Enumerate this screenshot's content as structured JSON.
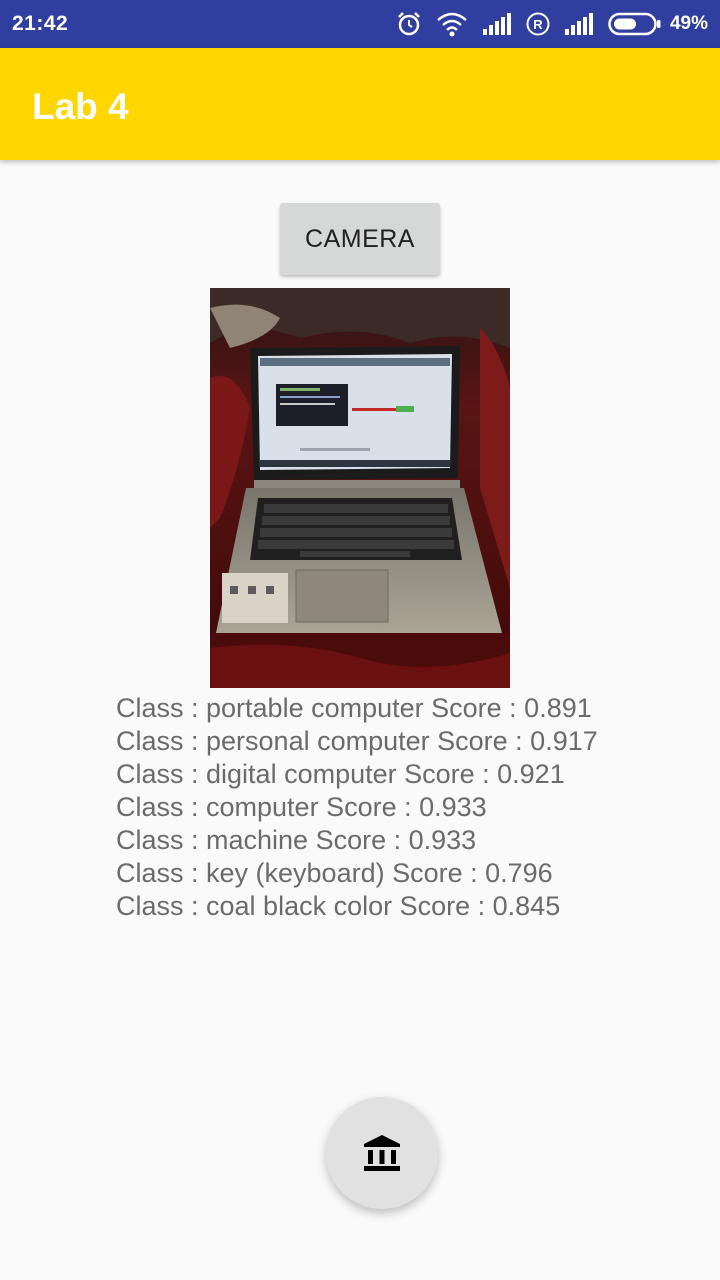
{
  "status_bar": {
    "time": "21:42",
    "battery_text": "49%",
    "icons": [
      "alarm-icon",
      "wifi-icon",
      "signal-icon",
      "roaming-icon",
      "signal-icon",
      "battery-icon"
    ]
  },
  "app_bar": {
    "title": "Lab 4",
    "color": "#ffd600"
  },
  "camera_button": {
    "label": "CAMERA"
  },
  "photo": {
    "description_icon": "laptop-photo"
  },
  "results": [
    "Class : portable computer Score : 0.891",
    "Class : personal computer Score : 0.917",
    "Class : digital computer Score : 0.921",
    "Class : computer Score : 0.933",
    "Class : machine Score : 0.933",
    "Class : key (keyboard) Score : 0.796",
    "Class : coal black color Score : 0.845"
  ],
  "fab": {
    "icon": "bank-icon"
  }
}
